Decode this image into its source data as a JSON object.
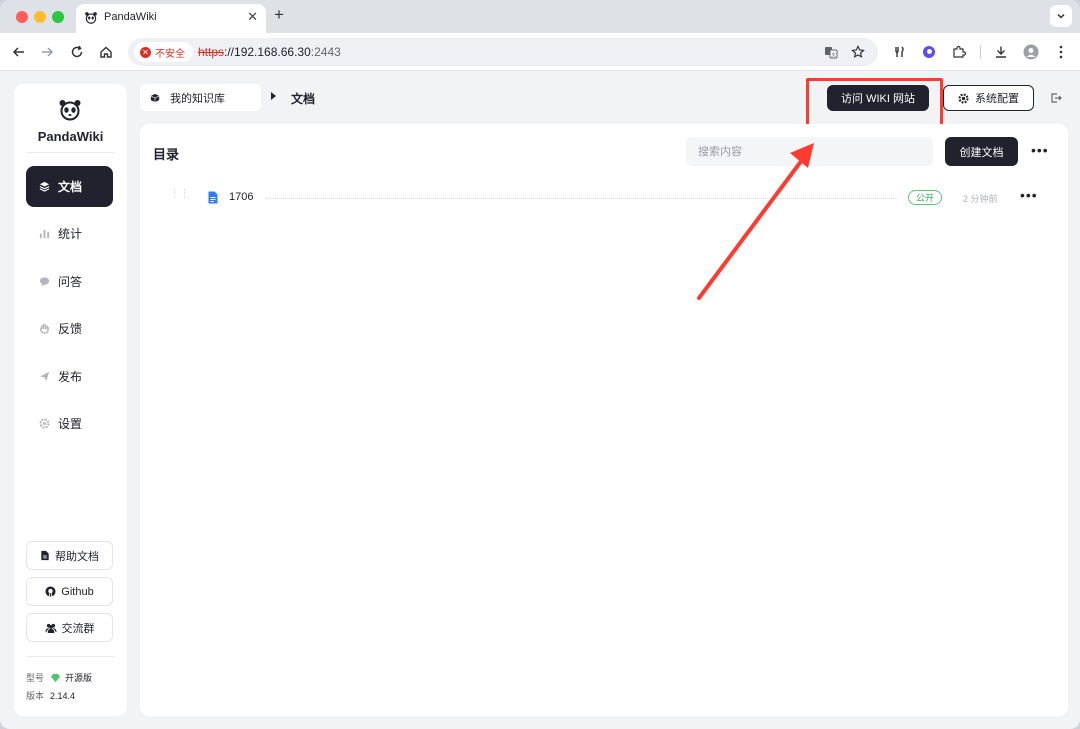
{
  "browser": {
    "tab_title": "PandaWiki",
    "insecure_label": "不安全",
    "url_scheme": "https",
    "url_host": "://192.168.66.30",
    "url_port": ":2443"
  },
  "sidebar": {
    "brand": "PandaWiki",
    "items": [
      {
        "label": "文档",
        "icon": "layers-icon",
        "active": true
      },
      {
        "label": "统计",
        "icon": "bar-chart-icon",
        "active": false
      },
      {
        "label": "问答",
        "icon": "chat-bubble-icon",
        "active": false
      },
      {
        "label": "反馈",
        "icon": "hand-icon",
        "active": false
      },
      {
        "label": "发布",
        "icon": "send-icon",
        "active": false
      },
      {
        "label": "设置",
        "icon": "gear-icon",
        "active": false
      }
    ],
    "help_label": "帮助文档",
    "github_label": "Github",
    "community_label": "交流群",
    "model_label": "型号",
    "model_value": "开源版",
    "version_label": "版本",
    "version_value": "2.14.4"
  },
  "header": {
    "knowledge_base": "我的知识库",
    "current_page": "文档",
    "visit_wiki_label": "访问 WIKI 网站",
    "system_config_label": "系统配置"
  },
  "main": {
    "title": "目录",
    "search_placeholder": "搜索内容",
    "create_label": "创建文档",
    "documents": [
      {
        "name": "1706",
        "status": "公开",
        "time": "2 分钟前"
      }
    ]
  },
  "colors": {
    "accent": "#21222d",
    "highlight": "#ff3b30",
    "public_green": "#3aa55d",
    "doc_blue": "#2f7bf5"
  }
}
